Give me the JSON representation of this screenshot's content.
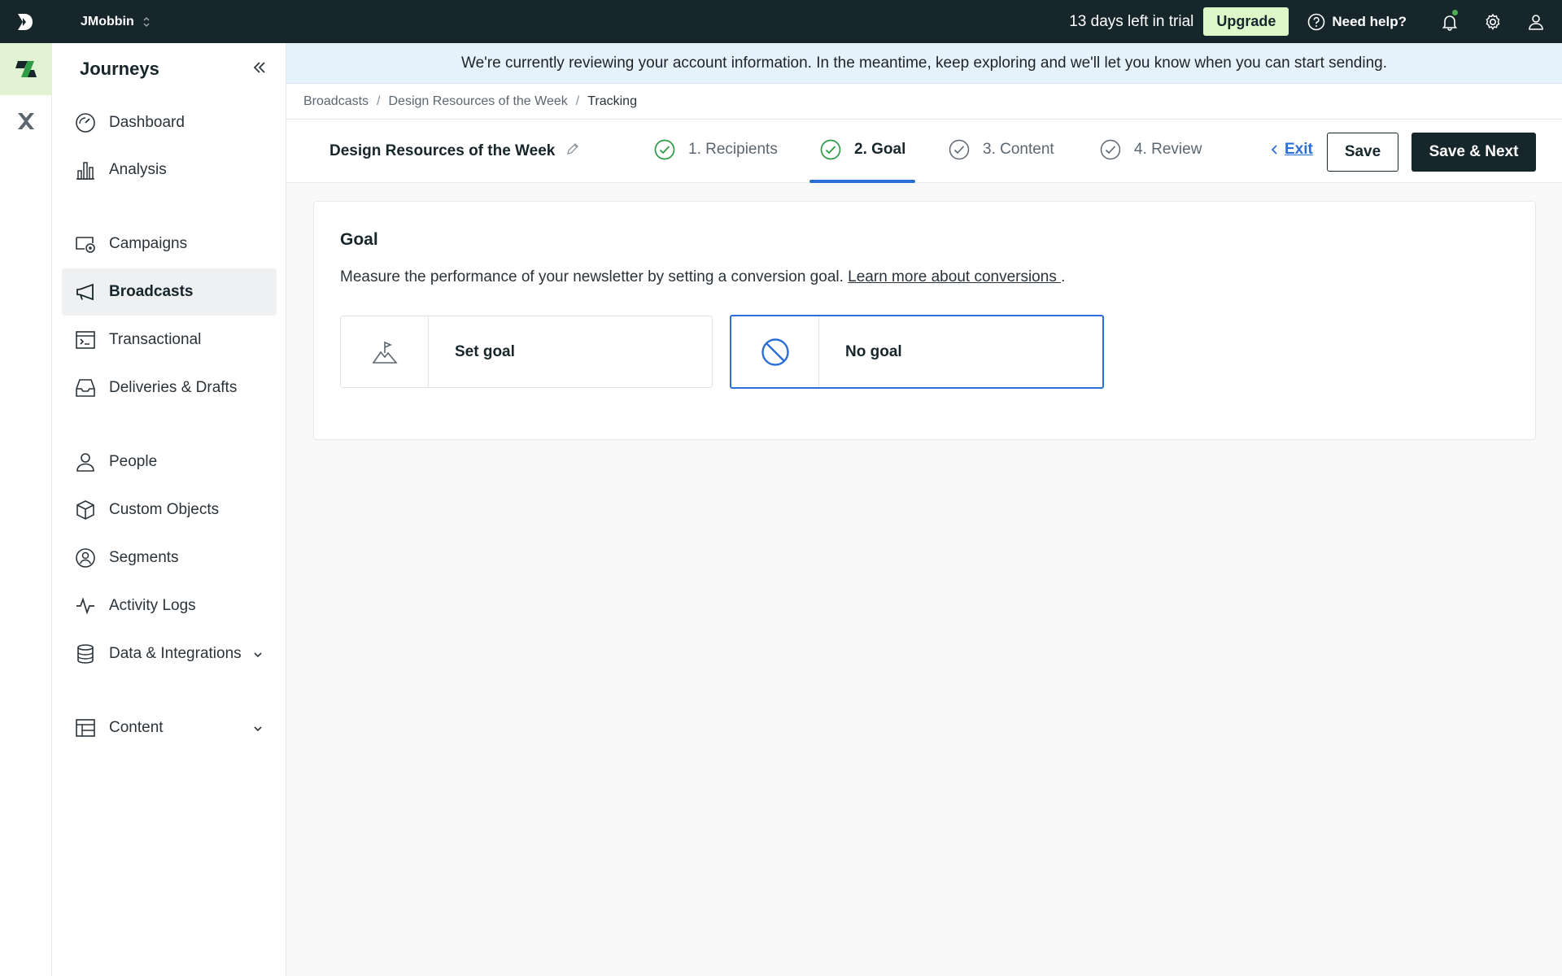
{
  "topbar": {
    "workspace": "JMobbin",
    "trial_text": "13 days left in trial",
    "upgrade_label": "Upgrade",
    "help_label": "Need help?"
  },
  "sidebar": {
    "title": "Journeys",
    "items": [
      {
        "label": "Dashboard",
        "icon": "dashboard-icon"
      },
      {
        "label": "Analysis",
        "icon": "bar-chart-icon"
      },
      {
        "label": "Campaigns",
        "icon": "campaigns-icon"
      },
      {
        "label": "Broadcasts",
        "icon": "megaphone-icon",
        "active": true
      },
      {
        "label": "Transactional",
        "icon": "terminal-icon"
      },
      {
        "label": "Deliveries & Drafts",
        "icon": "inbox-icon"
      },
      {
        "label": "People",
        "icon": "person-icon"
      },
      {
        "label": "Custom Objects",
        "icon": "cube-icon"
      },
      {
        "label": "Segments",
        "icon": "segments-icon"
      },
      {
        "label": "Activity Logs",
        "icon": "activity-icon"
      },
      {
        "label": "Data & Integrations",
        "icon": "database-icon"
      },
      {
        "label": "Content",
        "icon": "layout-icon"
      }
    ]
  },
  "banner": {
    "text": "We're currently reviewing your account information. In the meantime, keep exploring and we'll let you know when you can start sending."
  },
  "breadcrumb": [
    "Broadcasts",
    "Design Resources of the Week",
    "Tracking"
  ],
  "stepbar": {
    "title": "Design Resources of the Week",
    "steps": [
      "1. Recipients",
      "2. Goal",
      "3. Content",
      "4. Review"
    ],
    "active_step": "2. Goal",
    "exit_label": "Exit",
    "save_label": "Save",
    "save_next_label": "Save & Next"
  },
  "goal": {
    "title": "Goal",
    "description": "Measure the performance of your newsletter by setting a conversion goal.",
    "link_text": "Learn more about conversions ",
    "link_suffix": ".",
    "options": [
      {
        "label": "Set goal",
        "icon": "mountain-flag-icon",
        "selected": false
      },
      {
        "label": "No goal",
        "icon": "prohibited-icon",
        "selected": true
      }
    ]
  },
  "colors": {
    "topbar": "#17262b",
    "accent": "#2b6fd6",
    "upgrade": "#dff7c9",
    "success": "#2e9b47"
  }
}
